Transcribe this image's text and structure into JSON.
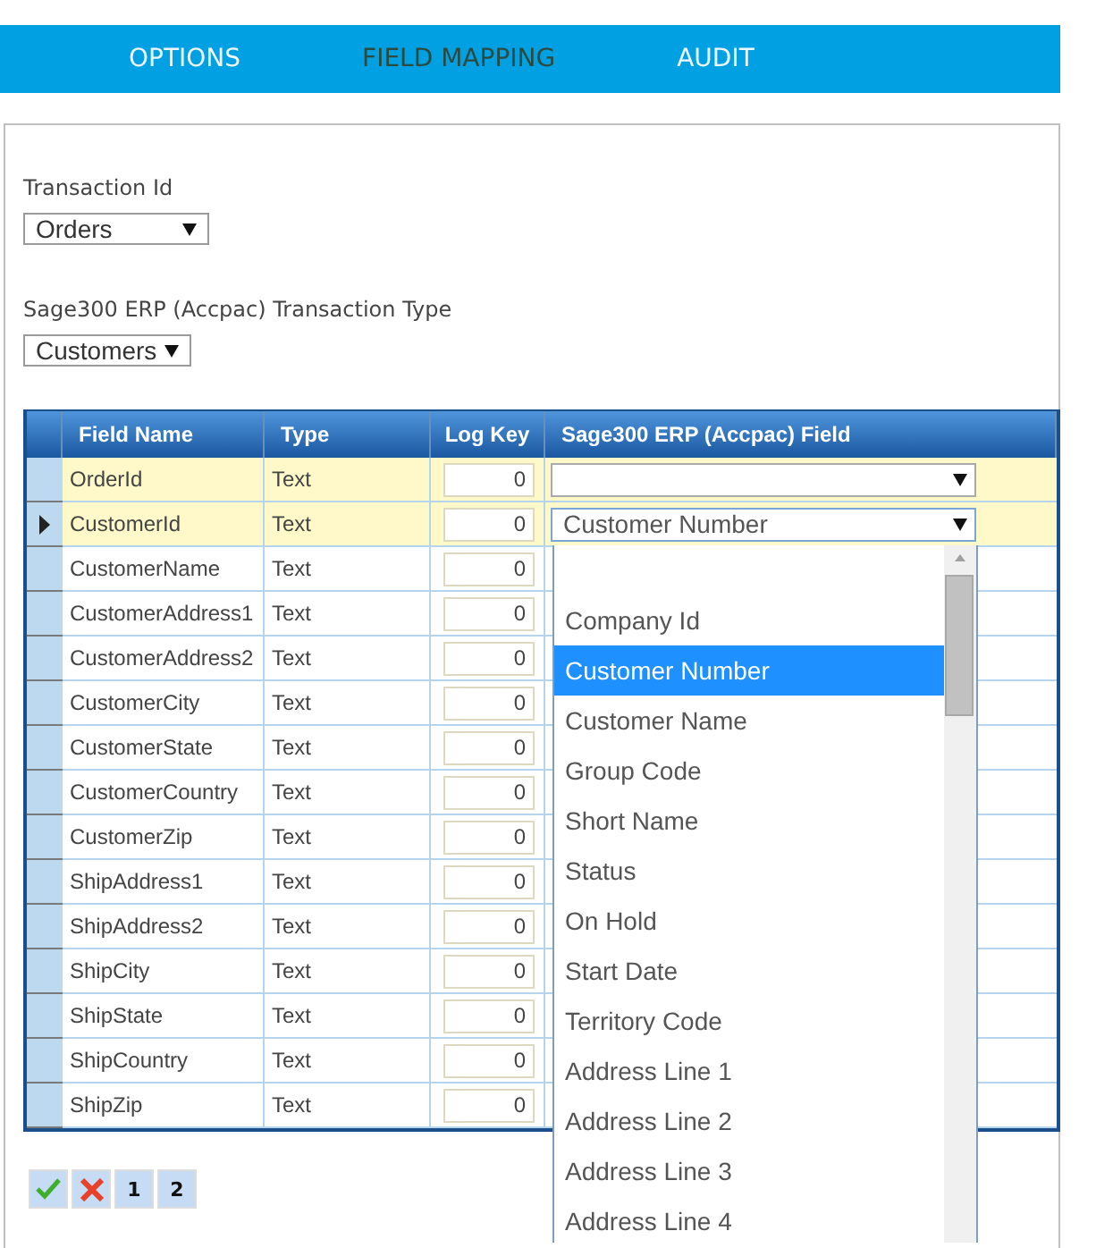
{
  "nav_tabs": [
    {
      "label": "OPTIONS",
      "selected": false
    },
    {
      "label": "FIELD MAPPING",
      "selected": true
    },
    {
      "label": "AUDIT",
      "selected": false
    }
  ],
  "transaction_id": {
    "label": "Transaction Id",
    "value": "Orders"
  },
  "transaction_type": {
    "label": "Sage300 ERP (Accpac) Transaction Type",
    "value": "Customers"
  },
  "grid": {
    "columns": [
      "Field Name",
      "Type",
      "Log Key",
      "Sage300 ERP (Accpac) Field"
    ],
    "rows": [
      {
        "field_name": "OrderId",
        "type": "Text",
        "log_key": "0",
        "editing": true,
        "current": false
      },
      {
        "field_name": "CustomerId",
        "type": "Text",
        "log_key": "0",
        "editing": true,
        "current": true,
        "sage_field": "Customer Number"
      },
      {
        "field_name": "CustomerName",
        "type": "Text",
        "log_key": "0",
        "editing": false,
        "current": false
      },
      {
        "field_name": "CustomerAddress1",
        "type": "Text",
        "log_key": "0",
        "editing": false,
        "current": false
      },
      {
        "field_name": "CustomerAddress2",
        "type": "Text",
        "log_key": "0",
        "editing": false,
        "current": false
      },
      {
        "field_name": "CustomerCity",
        "type": "Text",
        "log_key": "0",
        "editing": false,
        "current": false
      },
      {
        "field_name": "CustomerState",
        "type": "Text",
        "log_key": "0",
        "editing": false,
        "current": false
      },
      {
        "field_name": "CustomerCountry",
        "type": "Text",
        "log_key": "0",
        "editing": false,
        "current": false
      },
      {
        "field_name": "CustomerZip",
        "type": "Text",
        "log_key": "0",
        "editing": false,
        "current": false
      },
      {
        "field_name": "ShipAddress1",
        "type": "Text",
        "log_key": "0",
        "editing": false,
        "current": false
      },
      {
        "field_name": "ShipAddress2",
        "type": "Text",
        "log_key": "0",
        "editing": false,
        "current": false
      },
      {
        "field_name": "ShipCity",
        "type": "Text",
        "log_key": "0",
        "editing": false,
        "current": false
      },
      {
        "field_name": "ShipState",
        "type": "Text",
        "log_key": "0",
        "editing": false,
        "current": false
      },
      {
        "field_name": "ShipCountry",
        "type": "Text",
        "log_key": "0",
        "editing": false,
        "current": false
      },
      {
        "field_name": "ShipZip",
        "type": "Text",
        "log_key": "0",
        "editing": false,
        "current": false
      }
    ]
  },
  "dropdown_options": [
    {
      "label": "Company Id",
      "selected": false
    },
    {
      "label": "Customer Number",
      "selected": true
    },
    {
      "label": "Customer Name",
      "selected": false
    },
    {
      "label": "Group Code",
      "selected": false
    },
    {
      "label": "Short Name",
      "selected": false
    },
    {
      "label": "Status",
      "selected": false
    },
    {
      "label": "On Hold",
      "selected": false
    },
    {
      "label": "Start Date",
      "selected": false
    },
    {
      "label": "Territory Code",
      "selected": false
    },
    {
      "label": "Address Line 1",
      "selected": false
    },
    {
      "label": "Address Line 2",
      "selected": false
    },
    {
      "label": "Address Line 3",
      "selected": false
    },
    {
      "label": "Address Line 4",
      "selected": false
    }
  ],
  "pager": [
    {
      "kind": "save"
    },
    {
      "kind": "cancel"
    },
    {
      "kind": "page",
      "label": "1"
    },
    {
      "kind": "page",
      "label": "2"
    }
  ]
}
